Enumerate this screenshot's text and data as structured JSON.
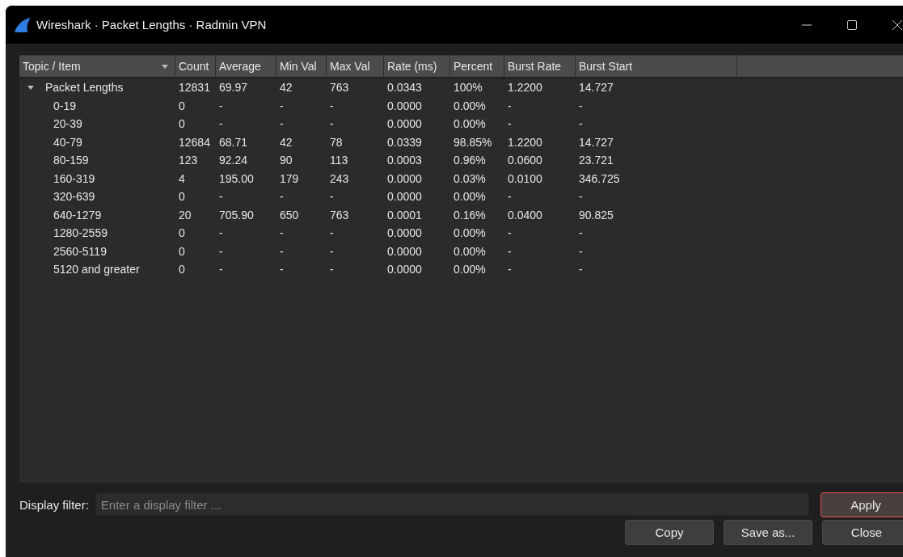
{
  "window": {
    "title": "Wireshark · Packet Lengths · Radmin VPN"
  },
  "table": {
    "columns": [
      {
        "label": "Topic / Item",
        "sorted": true
      },
      {
        "label": "Count",
        "sorted": false
      },
      {
        "label": "Average",
        "sorted": false
      },
      {
        "label": "Min Val",
        "sorted": false
      },
      {
        "label": "Max Val",
        "sorted": false
      },
      {
        "label": "Rate (ms)",
        "sorted": false
      },
      {
        "label": "Percent",
        "sorted": false
      },
      {
        "label": "Burst Rate",
        "sorted": false
      },
      {
        "label": "Burst Start",
        "sorted": false
      }
    ],
    "rows": [
      {
        "cells": [
          "Packet Lengths",
          "12831",
          "69.97",
          "42",
          "763",
          "0.0343",
          "100%",
          "1.2200",
          "14.727"
        ],
        "expanded": true,
        "children": [
          {
            "cells": [
              "0-19",
              "0",
              "-",
              "-",
              "-",
              "0.0000",
              "0.00%",
              "-",
              "-"
            ]
          },
          {
            "cells": [
              "20-39",
              "0",
              "-",
              "-",
              "-",
              "0.0000",
              "0.00%",
              "-",
              "-"
            ]
          },
          {
            "cells": [
              "40-79",
              "12684",
              "68.71",
              "42",
              "78",
              "0.0339",
              "98.85%",
              "1.2200",
              "14.727"
            ]
          },
          {
            "cells": [
              "80-159",
              "123",
              "92.24",
              "90",
              "113",
              "0.0003",
              "0.96%",
              "0.0600",
              "23.721"
            ]
          },
          {
            "cells": [
              "160-319",
              "4",
              "195.00",
              "179",
              "243",
              "0.0000",
              "0.03%",
              "0.0100",
              "346.725"
            ]
          },
          {
            "cells": [
              "320-639",
              "0",
              "-",
              "-",
              "-",
              "0.0000",
              "0.00%",
              "-",
              "-"
            ]
          },
          {
            "cells": [
              "640-1279",
              "20",
              "705.90",
              "650",
              "763",
              "0.0001",
              "0.16%",
              "0.0400",
              "90.825"
            ]
          },
          {
            "cells": [
              "1280-2559",
              "0",
              "-",
              "-",
              "-",
              "0.0000",
              "0.00%",
              "-",
              "-"
            ]
          },
          {
            "cells": [
              "2560-5119",
              "0",
              "-",
              "-",
              "-",
              "0.0000",
              "0.00%",
              "-",
              "-"
            ]
          },
          {
            "cells": [
              "5120 and greater",
              "0",
              "-",
              "-",
              "-",
              "0.0000",
              "0.00%",
              "-",
              "-"
            ]
          }
        ]
      }
    ]
  },
  "filter": {
    "label": "Display filter:",
    "placeholder": "Enter a display filter ..."
  },
  "buttons": [
    {
      "label": "Apply",
      "kind": "default"
    },
    {
      "label": "Copy",
      "kind": "normal"
    },
    {
      "label": "Save as...",
      "kind": "normal"
    },
    {
      "label": "Close",
      "kind": "normal"
    }
  ]
}
